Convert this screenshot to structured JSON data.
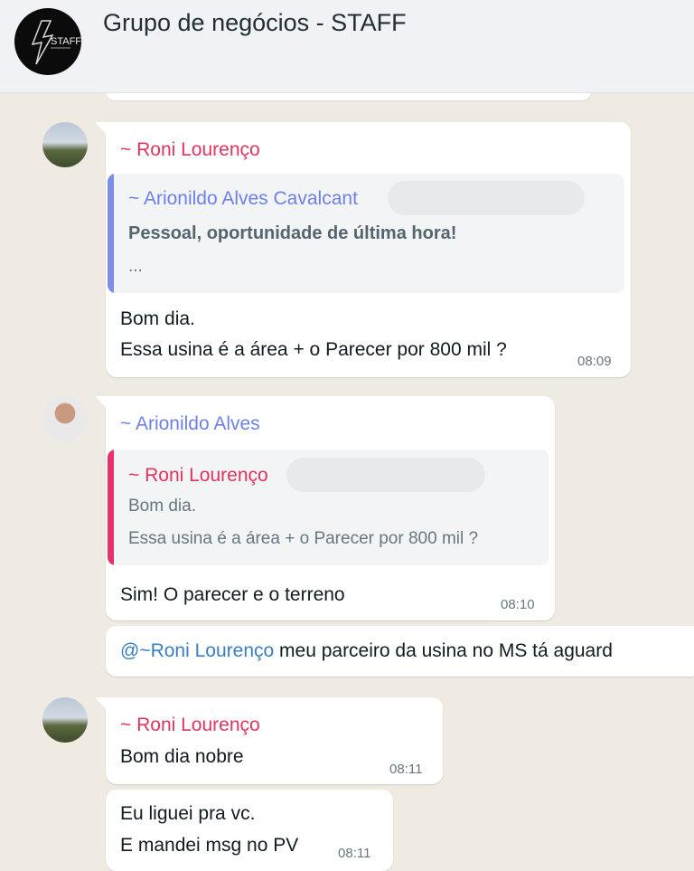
{
  "header": {
    "title": "Grupo de negócios - STAFF",
    "avatar_text": "STAFF"
  },
  "messages": [
    {
      "sender": "~ Roni Lourenço",
      "quote": {
        "sender": "~ Arionildo Alves Cavalcant",
        "title": "Pessoal, oportunidade de última hora!",
        "more": "..."
      },
      "lines": [
        "Bom dia.",
        "Essa usina é a área + o Parecer por 800 mil ?"
      ],
      "time": "08:09"
    },
    {
      "sender": "~ Arionildo Alves",
      "quote": {
        "sender": "~ Roni Lourenço",
        "lines": [
          "Bom dia.",
          "Essa usina é a área + o Parecer por 800 mil ?"
        ]
      },
      "lines": [
        "Sim! O parecer e o terreno"
      ],
      "time": "08:10"
    },
    {
      "mention": "@~Roni Lourenço",
      "text": " meu parceiro da usina no MS tá aguard"
    },
    {
      "sender": "~ Roni Lourenço",
      "lines": [
        "Bom dia nobre"
      ],
      "time": "08:11"
    },
    {
      "lines": [
        "Eu liguei pra vc.",
        "E mandei msg no PV"
      ],
      "time": "08:11"
    }
  ]
}
